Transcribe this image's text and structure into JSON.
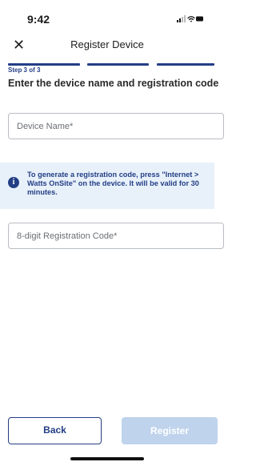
{
  "status_bar": {
    "time": "9:42"
  },
  "nav": {
    "title": "Register Device"
  },
  "steps": {
    "label": "Step 3 of 3",
    "total": 3,
    "current": 3
  },
  "heading": "Enter the device name and registration code",
  "device_name_field": {
    "placeholder": "Device Name*",
    "value": ""
  },
  "info": {
    "icon": "info-icon",
    "text": "To generate a registration code, press \"Internet > Watts OnSite\" on the device. It will be valid for 30 minutes."
  },
  "registration_code_field": {
    "placeholder": "8-digit Registration Code*",
    "value": ""
  },
  "buttons": {
    "back_label": "Back",
    "register_label": "Register",
    "register_enabled": false
  },
  "colors": {
    "primary": "#233e86",
    "info_background": "#e8f1fa",
    "disabled_button": "#bfd3ec"
  }
}
